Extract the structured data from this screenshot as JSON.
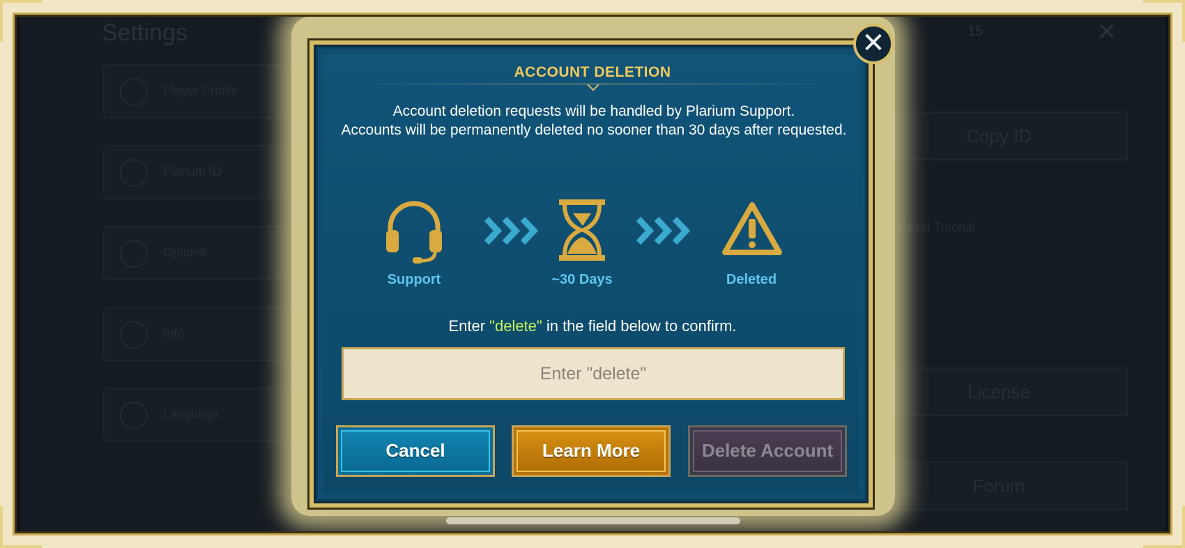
{
  "background": {
    "title": "Settings",
    "menu_items": [
      {
        "label": "Player Profile"
      },
      {
        "label": "Plarium ID"
      },
      {
        "label": "Options"
      },
      {
        "label": "Info"
      },
      {
        "label": "Language"
      }
    ],
    "right_buttons": [
      {
        "label": "Copy ID"
      },
      {
        "label": "License"
      },
      {
        "label": "Forum"
      }
    ],
    "right_text": "Reset Tutorial",
    "top_count": "15"
  },
  "modal": {
    "title": "ACCOUNT DELETION",
    "description_line1": "Account deletion requests will be handled by Plarium Support.",
    "description_line2": "Accounts will be permanently deleted no sooner than 30 days after requested.",
    "steps": [
      {
        "label": "Support",
        "icon": "headset-icon"
      },
      {
        "label": "~30 Days",
        "icon": "hourglass-icon"
      },
      {
        "label": "Deleted",
        "icon": "warning-icon"
      }
    ],
    "confirm_prefix": "Enter ",
    "confirm_keyword": "\"delete\"",
    "confirm_suffix": " in the field below to confirm.",
    "input_placeholder": "Enter \"delete\"",
    "input_value": "",
    "buttons": {
      "cancel": "Cancel",
      "learn_more": "Learn More",
      "delete_account": "Delete Account"
    },
    "close_glyph": "✕"
  },
  "colors": {
    "accent_gold": "#d6bd68",
    "title_gold": "#f1c95c",
    "step_blue": "#5ec6ef",
    "keyword_green": "#c7f25a"
  }
}
